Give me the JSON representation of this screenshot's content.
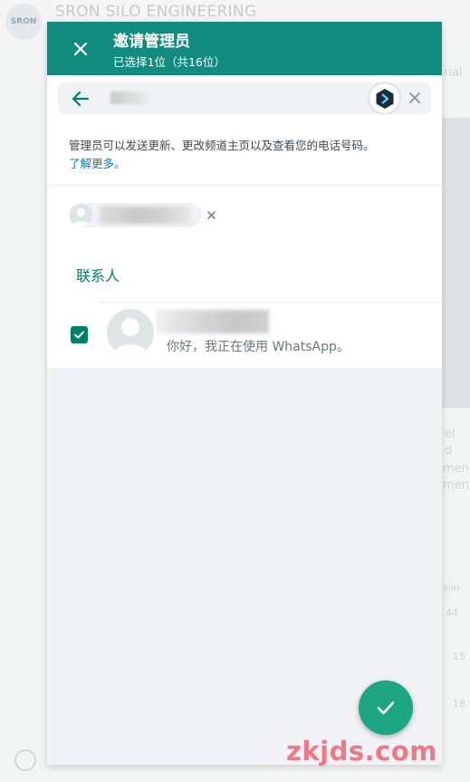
{
  "background": {
    "logo_text": "SRON",
    "header_title": "SRON SILO ENGINEERING",
    "fragments": [
      "rial",
      "el",
      "d",
      "men",
      "ment",
      "silo",
      "44",
      "15",
      "18"
    ]
  },
  "modal": {
    "title": "邀请管理员",
    "subtitle": "已选择1位（共16位）",
    "search": {
      "placeholder": "",
      "value": ""
    },
    "info_text": "管理员可以发送更新、更改频道主页以及查看您的电话号码。",
    "learn_more": "了解更多。",
    "section_label": "联系人",
    "contacts": [
      {
        "name": "",
        "status": "你好，我正在使用 WhatsApp。",
        "checked": true
      }
    ]
  },
  "watermark": "zkjds.com",
  "colors": {
    "header_green": "#128c7e",
    "accent_green": "#008069",
    "fab_green": "#1ea584",
    "link_blue": "#027eb5"
  },
  "icons": {
    "close": "close-icon",
    "back": "arrow-left-icon",
    "extension": "extension-icon",
    "clear": "close-icon",
    "check": "check-icon",
    "send": "check-icon"
  }
}
